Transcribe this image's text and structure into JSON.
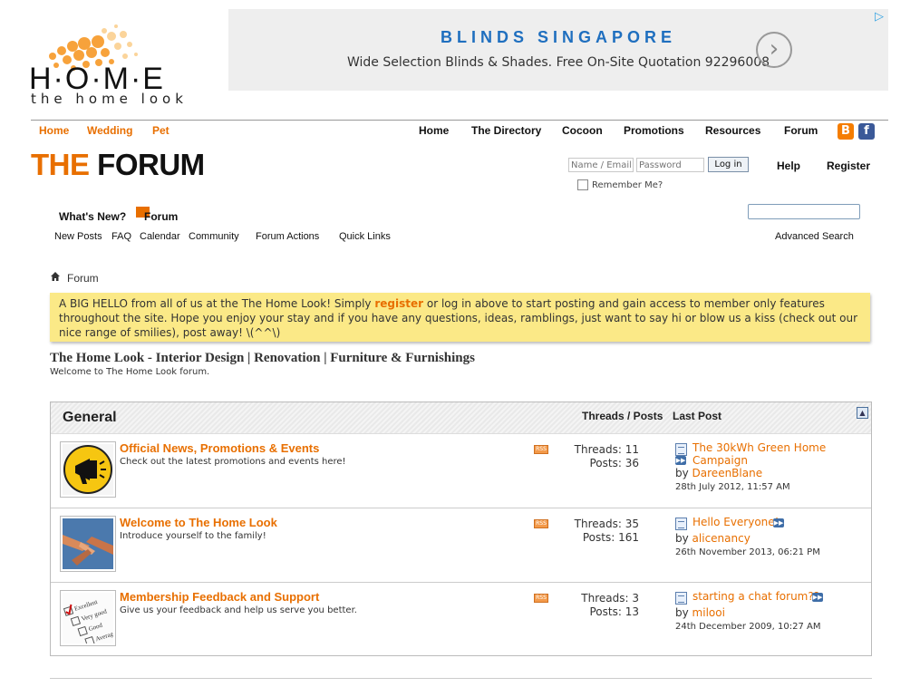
{
  "logo": {
    "letters": "H·O·M·E",
    "tagline": "the home look"
  },
  "ad": {
    "title": "BLINDS SINGAPORE",
    "text": "Wide Selection Blinds & Shades. Free On-Site Quotation 92296008",
    "arrow": "›",
    "choices": "▷"
  },
  "topnav": {
    "left": [
      "Home",
      "Wedding",
      "Pet"
    ],
    "right": [
      "Home",
      "The Directory",
      "Cocoon",
      "Promotions",
      "Resources",
      "Forum"
    ],
    "social": {
      "blogger": "B",
      "facebook": "f"
    }
  },
  "forum_title": {
    "part1": "THE",
    "part2": "FORUM"
  },
  "login": {
    "name_placeholder": "Name / Email",
    "password_placeholder": "Password",
    "login_label": "Log in",
    "remember_label": "Remember Me?",
    "help": "Help",
    "register": "Register"
  },
  "tabs": {
    "whats_new": "What's New?",
    "forum": "Forum"
  },
  "subnav": [
    "New Posts",
    "FAQ",
    "Calendar",
    "Community",
    "Forum Actions",
    "Quick Links"
  ],
  "search": {
    "advanced": "Advanced Search"
  },
  "breadcrumb": "Forum",
  "notice": {
    "before": "A BIG HELLO from all of us at the The Home Look! Simply ",
    "link": "register",
    "after": " or log in above to start posting and gain access to member only features throughout the site. Hope you enjoy your stay and if you have any questions, ideas, ramblings, just want to say hi or blow us a kiss (check out our nice range of smilies), post away! \\(^^\\)"
  },
  "site": {
    "title": "The Home Look - Interior Design | Renovation | Furniture & Furnishings",
    "subtitle": "Welcome to The Home Look forum."
  },
  "category": {
    "title": "General",
    "header_threads_posts": "Threads / Posts",
    "header_last_post": "Last Post",
    "forums": [
      {
        "title": "Official News, Promotions & Events",
        "description": "Check out the latest promotions and events here!",
        "threads": "Threads: 11",
        "posts": "Posts: 36",
        "last_title": "The 30kWh Green Home Campaign",
        "last_by": "by",
        "last_user": "DareenBlane",
        "last_date": "28th July 2012, 11:57 AM"
      },
      {
        "title": "Welcome to The Home Look",
        "description": "Introduce yourself to the family!",
        "threads": "Threads: 35",
        "posts": "Posts: 161",
        "last_title": "Hello Everyone!",
        "last_by": "by",
        "last_user": "alicenancy",
        "last_date": "26th November 2013, 06:21 PM"
      },
      {
        "title": "Membership Feedback and Support",
        "description": "Give us your feedback and help us serve you better.",
        "threads": "Threads: 3",
        "posts": "Posts: 13",
        "last_title": "starting a chat forum??",
        "last_by": "by",
        "last_user": "milooi",
        "last_date": "24th December 2009, 10:27 AM"
      }
    ]
  },
  "feedback_thumb": {
    "line1": "Excellent",
    "line2": "Very good",
    "line3": "Good",
    "line4": "Average"
  },
  "rss_label": "RSS",
  "colors": {
    "accent": "#e86f00",
    "notice_bg": "#fbe987",
    "ad_title": "#1f6fbf"
  }
}
